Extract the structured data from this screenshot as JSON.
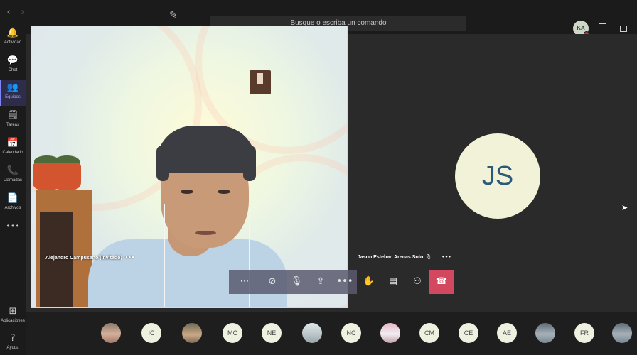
{
  "titlebar": {
    "back": "‹",
    "forward": "›",
    "search_placeholder": "Busque o escriba un comando",
    "user_initials": "KA"
  },
  "rail": {
    "items": [
      {
        "label": "Actividad",
        "icon": "🔔"
      },
      {
        "label": "Chat",
        "icon": "💬"
      },
      {
        "label": "Equipos",
        "icon": "👥"
      },
      {
        "label": "Tareas",
        "icon": "🗒"
      },
      {
        "label": "Calendario",
        "icon": "📅"
      },
      {
        "label": "Llamadas",
        "icon": "📞"
      },
      {
        "label": "Archivos",
        "icon": "📄"
      }
    ],
    "more": "•••",
    "apps_label": "Aplicaciones",
    "help_label": "Ayuda"
  },
  "call": {
    "main_participant": "Alejandro Campusano (Invitado)",
    "other_participant": "Jason Esteban Arenas Soto",
    "other_initials": "JS",
    "more": "•••"
  },
  "strip": {
    "participants": [
      "",
      "IC",
      "",
      "MC",
      "NE",
      "",
      "NC",
      "",
      "CM",
      "CE",
      "AE",
      "",
      "FR",
      ""
    ]
  },
  "colors": {
    "hangup": "#d1485f",
    "active_rail": "#7f85f5",
    "avatar_text": "#2c5a7a"
  }
}
